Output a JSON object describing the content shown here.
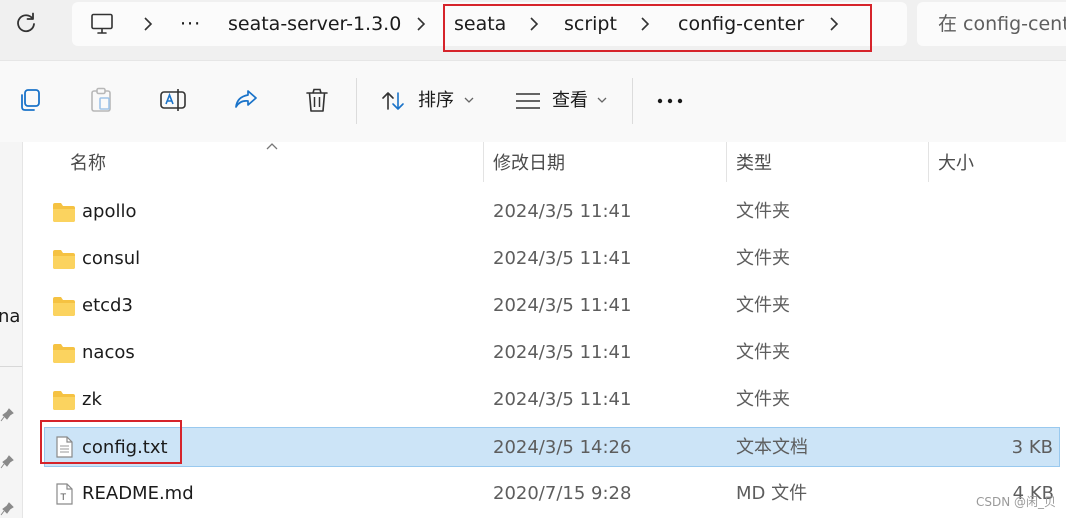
{
  "address_bar": {
    "crumbs": [
      "seata-server-1.3.0",
      "seata",
      "script",
      "config-center"
    ],
    "search_placeholder": "在 config-center 中搜索"
  },
  "toolbar": {
    "sort_label": "排序",
    "view_label": "查看"
  },
  "sidebar": {
    "truncated_label": "nal"
  },
  "columns": {
    "name": "名称",
    "modified": "修改日期",
    "type": "类型",
    "size": "大小"
  },
  "files": [
    {
      "name": "apollo",
      "modified": "2024/3/5 11:41",
      "type": "文件夹",
      "size": "",
      "icon": "folder-icon"
    },
    {
      "name": "consul",
      "modified": "2024/3/5 11:41",
      "type": "文件夹",
      "size": "",
      "icon": "folder-icon"
    },
    {
      "name": "etcd3",
      "modified": "2024/3/5 11:41",
      "type": "文件夹",
      "size": "",
      "icon": "folder-icon"
    },
    {
      "name": "nacos",
      "modified": "2024/3/5 11:41",
      "type": "文件夹",
      "size": "",
      "icon": "folder-icon"
    },
    {
      "name": "zk",
      "modified": "2024/3/5 11:41",
      "type": "文件夹",
      "size": "",
      "icon": "folder-icon"
    },
    {
      "name": "config.txt",
      "modified": "2024/3/5 14:26",
      "type": "文本文档",
      "size": "3 KB",
      "icon": "text-file-icon"
    },
    {
      "name": "README.md",
      "modified": "2020/7/15 9:28",
      "type": "MD 文件",
      "size": "4 KB",
      "icon": "markdown-file-icon"
    }
  ],
  "watermark": "CSDN @闲_贝",
  "colors": {
    "selection": "#cce4f7",
    "highlight_box": "#d6242b",
    "folder": "#f5c242"
  }
}
